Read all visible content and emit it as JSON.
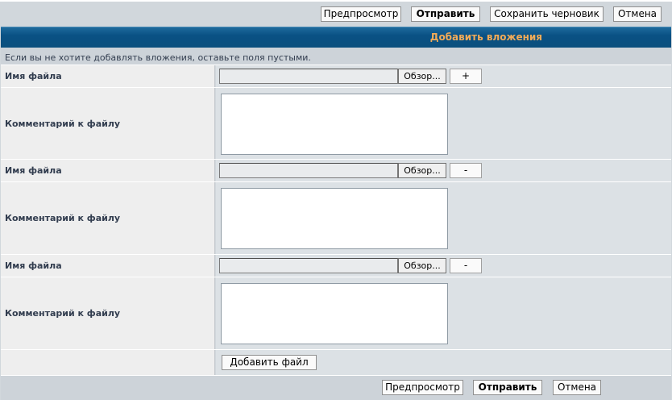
{
  "toolbar_top": {
    "preview": "Предпросмотр",
    "submit": "Отправить",
    "save_draft": "Сохранить черновик",
    "cancel": "Отмена"
  },
  "section": {
    "title": "Добавить вложения",
    "notice": "Если вы не хотите добавлять вложения, оставьте поля пустыми."
  },
  "attachments": [
    {
      "file_label": "Имя файла",
      "browse": "Обзор...",
      "toggle": "+",
      "comment_label": "Комментарий к файлу"
    },
    {
      "file_label": "Имя файла",
      "browse": "Обзор...",
      "toggle": "-",
      "comment_label": "Комментарий к файлу"
    },
    {
      "file_label": "Имя файла",
      "browse": "Обзор...",
      "toggle": "-",
      "comment_label": "Комментарий к файлу"
    }
  ],
  "add_file": "Добавить файл",
  "toolbar_bottom": {
    "preview": "Предпросмотр",
    "submit": "Отправить",
    "cancel": "Отмена"
  },
  "colors": {
    "header_bg": "#0a5184",
    "header_text": "#f2ab58",
    "label_bg": "#eeeeee",
    "field_bg": "#dce1e5"
  }
}
